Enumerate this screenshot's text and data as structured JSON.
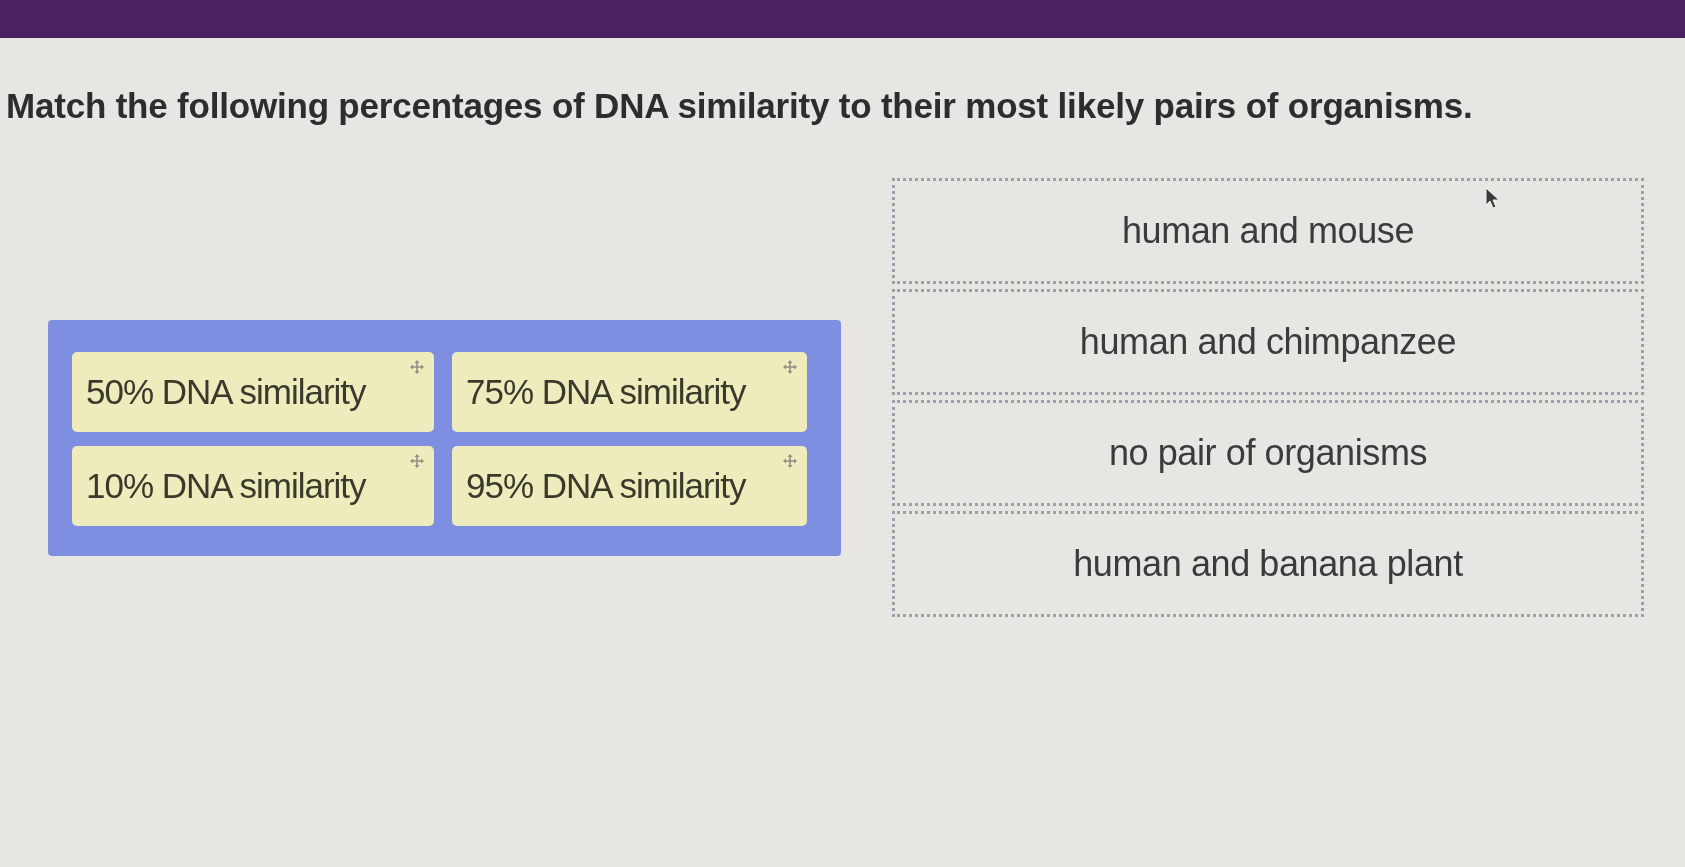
{
  "question": "Match the following percentages of DNA similarity to their most likely pairs of organisms.",
  "answer_bank": {
    "tiles": [
      {
        "label": "50% DNA similarity"
      },
      {
        "label": "75% DNA similarity"
      },
      {
        "label": "10% DNA similarity"
      },
      {
        "label": "95% DNA similarity"
      }
    ]
  },
  "drop_zones": [
    {
      "label": "human and mouse"
    },
    {
      "label": "human and chimpanzee"
    },
    {
      "label": "no pair of organisms"
    },
    {
      "label": "human and banana plant"
    }
  ]
}
